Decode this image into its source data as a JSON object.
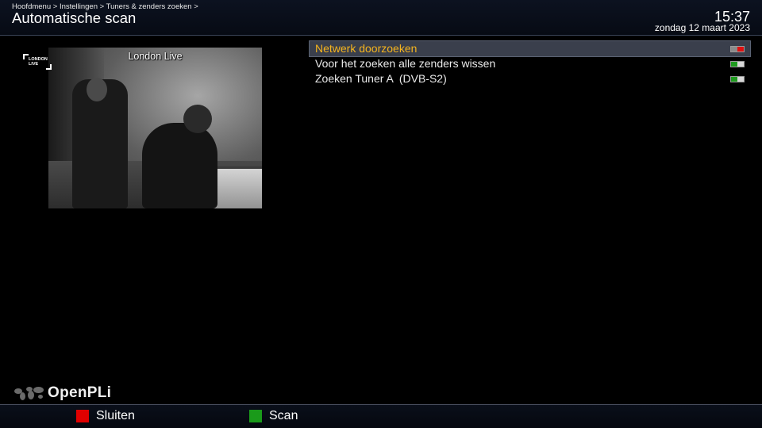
{
  "header": {
    "breadcrumb": "Hoofdmenu > Instellingen > Tuners & zenders zoeken >",
    "title": "Automatische scan",
    "time": "15:37",
    "date": "zondag 12 maart 2023"
  },
  "pip": {
    "channel_name": "London Live",
    "logo_text": "LONDON LIVE"
  },
  "config": {
    "items": [
      {
        "label": "Netwerk doorzoeken",
        "value": "off",
        "selected": true
      },
      {
        "label": "Voor het zoeken alle zenders wissen",
        "value": "on",
        "selected": false
      },
      {
        "label": "Zoeken Tuner A  (DVB-S2)",
        "value": "on",
        "selected": false
      }
    ]
  },
  "branding": {
    "name": "OpenPLi",
    "icon": "world-map-icon"
  },
  "footer": {
    "red_label": "Sluiten",
    "green_label": "Scan"
  },
  "colors": {
    "selected_text": "#f5b41e",
    "toggle_off": "#e01010",
    "toggle_on": "#1e9a1e",
    "button_red": "#e00000",
    "button_green": "#1a9a1a"
  }
}
